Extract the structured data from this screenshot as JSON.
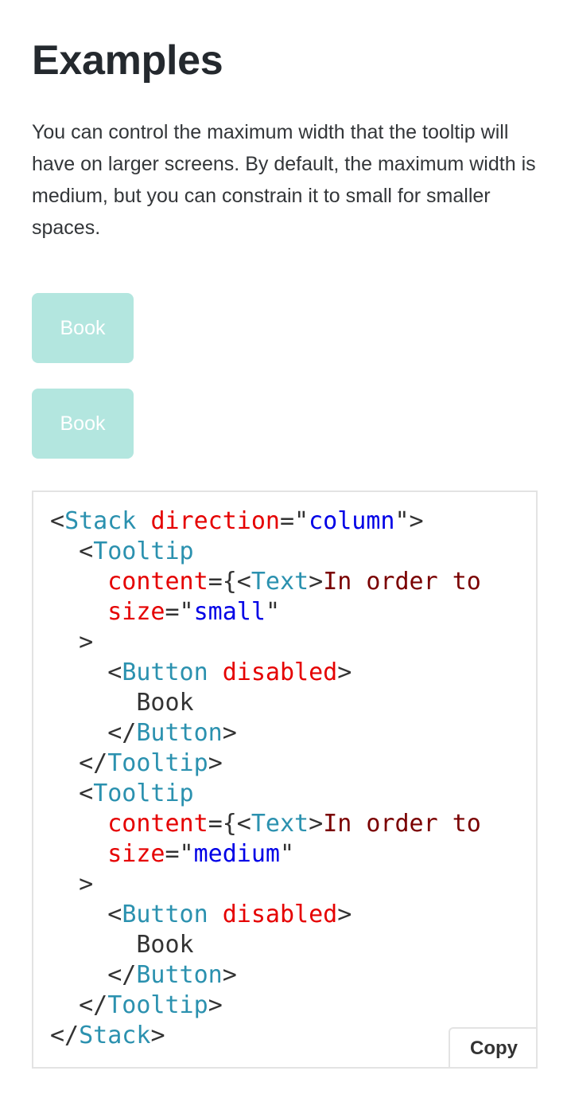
{
  "heading": "Examples",
  "description": "You can control the maximum width that the tooltip will have on larger screens. By default, the maximum width is medium, but you can constrain it to small for smaller spaces.",
  "demo": {
    "buttons": [
      {
        "label": "Book",
        "disabled": true
      },
      {
        "label": "Book",
        "disabled": true
      }
    ]
  },
  "code": {
    "copy_label": "Copy",
    "lines": [
      [
        [
          "punc",
          "<"
        ],
        [
          "tag",
          "Stack"
        ],
        [
          "plain",
          " "
        ],
        [
          "attr",
          "direction"
        ],
        [
          "punc",
          "=\""
        ],
        [
          "str",
          "column"
        ],
        [
          "punc",
          "\">"
        ]
      ],
      [
        [
          "plain",
          "  "
        ],
        [
          "punc",
          "<"
        ],
        [
          "tag",
          "Tooltip"
        ]
      ],
      [
        [
          "plain",
          "    "
        ],
        [
          "attr",
          "content"
        ],
        [
          "punc",
          "={<"
        ],
        [
          "tag",
          "Text"
        ],
        [
          "punc",
          ">"
        ],
        [
          "text",
          "In order to"
        ]
      ],
      [
        [
          "plain",
          "    "
        ],
        [
          "attr",
          "size"
        ],
        [
          "punc",
          "=\""
        ],
        [
          "str",
          "small"
        ],
        [
          "punc",
          "\""
        ]
      ],
      [
        [
          "plain",
          "  "
        ],
        [
          "punc",
          ">"
        ]
      ],
      [
        [
          "plain",
          "    "
        ],
        [
          "punc",
          "<"
        ],
        [
          "tag",
          "Button"
        ],
        [
          "plain",
          " "
        ],
        [
          "attr",
          "disabled"
        ],
        [
          "punc",
          ">"
        ]
      ],
      [
        [
          "plain",
          "      Book"
        ]
      ],
      [
        [
          "plain",
          "    "
        ],
        [
          "punc",
          "</"
        ],
        [
          "tag",
          "Button"
        ],
        [
          "punc",
          ">"
        ]
      ],
      [
        [
          "plain",
          "  "
        ],
        [
          "punc",
          "</"
        ],
        [
          "tag",
          "Tooltip"
        ],
        [
          "punc",
          ">"
        ]
      ],
      [
        [
          "plain",
          "  "
        ],
        [
          "punc",
          "<"
        ],
        [
          "tag",
          "Tooltip"
        ]
      ],
      [
        [
          "plain",
          "    "
        ],
        [
          "attr",
          "content"
        ],
        [
          "punc",
          "={<"
        ],
        [
          "tag",
          "Text"
        ],
        [
          "punc",
          ">"
        ],
        [
          "text",
          "In order to"
        ]
      ],
      [
        [
          "plain",
          "    "
        ],
        [
          "attr",
          "size"
        ],
        [
          "punc",
          "=\""
        ],
        [
          "str",
          "medium"
        ],
        [
          "punc",
          "\""
        ]
      ],
      [
        [
          "plain",
          "  "
        ],
        [
          "punc",
          ">"
        ]
      ],
      [
        [
          "plain",
          "    "
        ],
        [
          "punc",
          "<"
        ],
        [
          "tag",
          "Button"
        ],
        [
          "plain",
          " "
        ],
        [
          "attr",
          "disabled"
        ],
        [
          "punc",
          ">"
        ]
      ],
      [
        [
          "plain",
          "      Book"
        ]
      ],
      [
        [
          "plain",
          "    "
        ],
        [
          "punc",
          "</"
        ],
        [
          "tag",
          "Button"
        ],
        [
          "punc",
          ">"
        ]
      ],
      [
        [
          "plain",
          "  "
        ],
        [
          "punc",
          "</"
        ],
        [
          "tag",
          "Tooltip"
        ],
        [
          "punc",
          ">"
        ]
      ],
      [
        [
          "punc",
          "</"
        ],
        [
          "tag",
          "Stack"
        ],
        [
          "punc",
          ">"
        ]
      ]
    ]
  },
  "colors": {
    "button_disabled_bg": "#b3e6df",
    "tag": "#2b91af",
    "attr": "#e50000",
    "string": "#0000e6",
    "text_content": "#7a0000"
  }
}
